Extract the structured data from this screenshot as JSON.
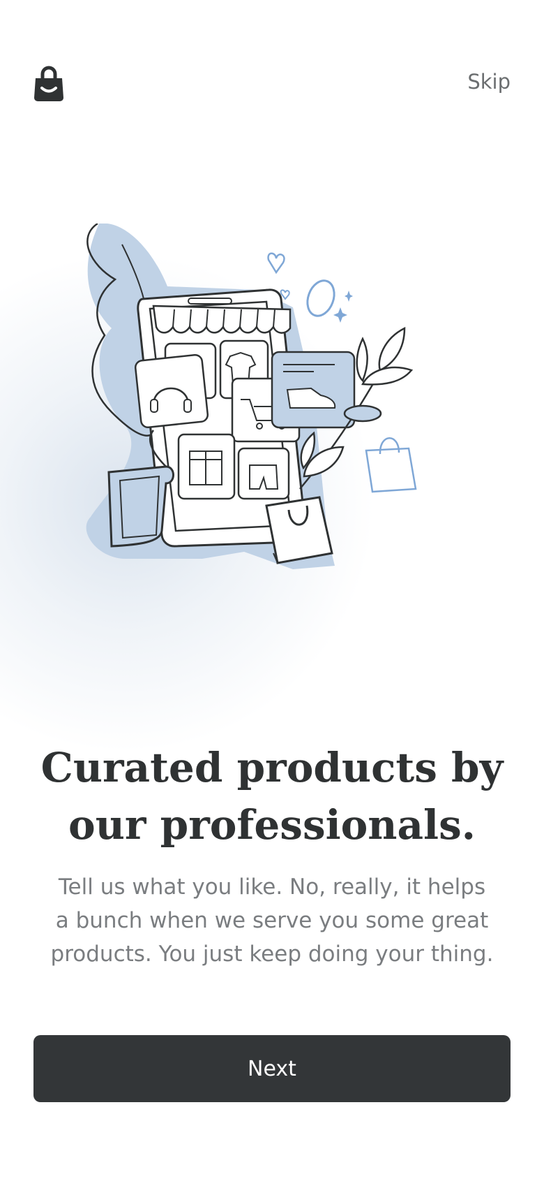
{
  "header": {
    "logo_icon": "shopping-bag-smile-icon",
    "skip_label": "Skip"
  },
  "illustration": {
    "icon": "phone-storefront-illustration"
  },
  "content": {
    "headline": "Curated products by our professionals.",
    "description": "Tell us what you like. No, really, it helps a bunch when we serve you some great products. You just keep doing your thing."
  },
  "actions": {
    "next_label": "Next"
  },
  "colors": {
    "background": "#ffffff",
    "text_dark": "#2f3233",
    "text_muted": "#7a7d80",
    "button_bg": "#333638",
    "accent_blue": "#c0d2e6",
    "accent_line_blue": "#7fa7d6"
  }
}
